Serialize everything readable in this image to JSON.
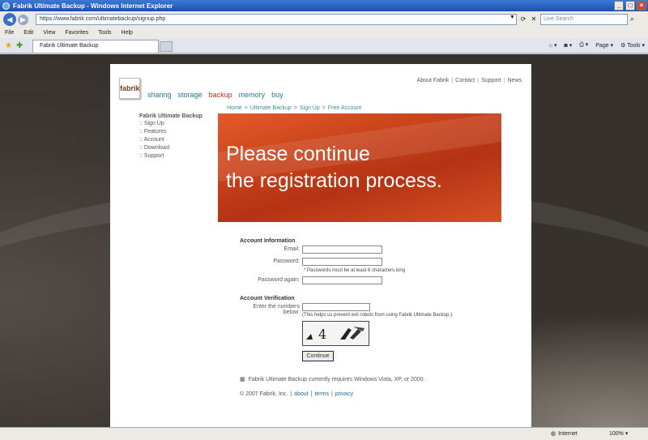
{
  "window": {
    "title": "Fabrik Ultimate Backup - Windows Internet Explorer"
  },
  "browser": {
    "url": "https://www.fabrik.com/ultimatebackup/signup.php",
    "search_placeholder": "Live Search",
    "menu": [
      "File",
      "Edit",
      "View",
      "Favorites",
      "Tools",
      "Help"
    ],
    "tab_label": "Fabrik Ultimate Backup",
    "cmd": {
      "page": "Page",
      "tools": "Tools"
    }
  },
  "site": {
    "logo": "fabrik",
    "nav": [
      "sharing",
      "storage",
      "backup",
      "memory",
      "buy"
    ],
    "top_links": [
      "About Fabrik",
      "Contact",
      "Support",
      "News"
    ],
    "breadcrumb": [
      "Home",
      "Ultimate Backup",
      "Sign Up",
      "Free Account"
    ],
    "sidebar": {
      "title": "Fabrik Ultimate Backup",
      "items": [
        ":: Sign Up",
        ":: Features",
        ":: Account",
        ":: Download",
        ":: Support"
      ]
    },
    "banner": {
      "line1": "Please continue",
      "line2": "the registration process."
    },
    "form": {
      "account_title": "Account Information",
      "email_label": "Email:",
      "password_label": "Password:",
      "password_hint": "* Passwords must be at least 6 characters long",
      "password_again_label": "Password again:",
      "verify_title": "Account Verification",
      "numbers_label_1": "Enter the numbers",
      "numbers_label_2": "below:",
      "numbers_hint": "(This helps us prevent evil robots from using Fabrik Ultimate Backup.)",
      "captcha_text": "4",
      "continue_label": "Continue"
    },
    "notice": "Fabrik Ultimate Backup currently requires Windows Vista, XP, or 2000.",
    "footer": {
      "copyright": "© 2007 Fabrik, Inc.",
      "links": [
        "about",
        "terms",
        "privacy"
      ]
    }
  },
  "status": {
    "zone": "Internet",
    "zoom": "100%"
  }
}
